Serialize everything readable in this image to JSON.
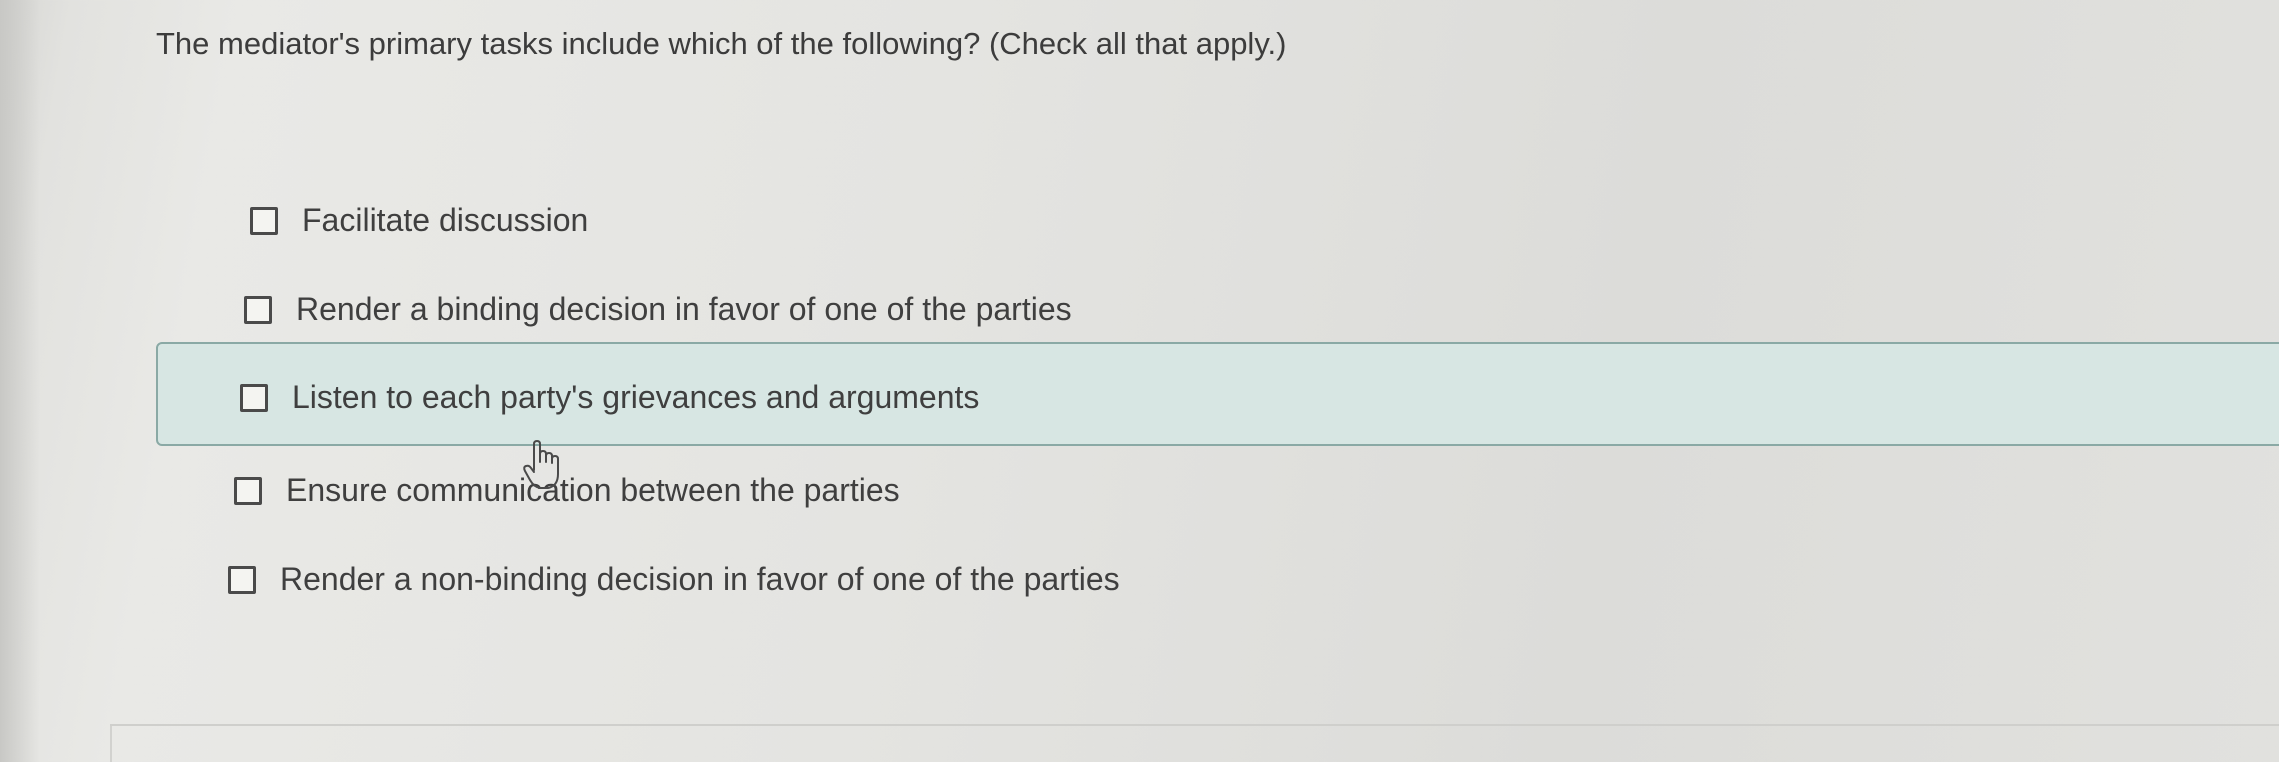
{
  "question": {
    "text": "The mediator's primary tasks include which of the following? (Check all that apply.)"
  },
  "options": [
    {
      "label": "Facilitate discussion",
      "checked": false,
      "highlighted": false
    },
    {
      "label": "Render a binding decision in favor of one of the parties",
      "checked": false,
      "highlighted": false
    },
    {
      "label": "Listen to each party's grievances and arguments",
      "checked": false,
      "highlighted": true
    },
    {
      "label": "Ensure communication between the parties",
      "checked": false,
      "highlighted": false
    },
    {
      "label": "Render a non-binding decision in favor of one of the parties",
      "checked": false,
      "highlighted": false
    }
  ],
  "colors": {
    "highlight_background": "#d7e6e3",
    "highlight_border": "#8aa9a5",
    "text": "#3f3f3f"
  },
  "cursor": {
    "icon": "hand-pointer-icon"
  }
}
